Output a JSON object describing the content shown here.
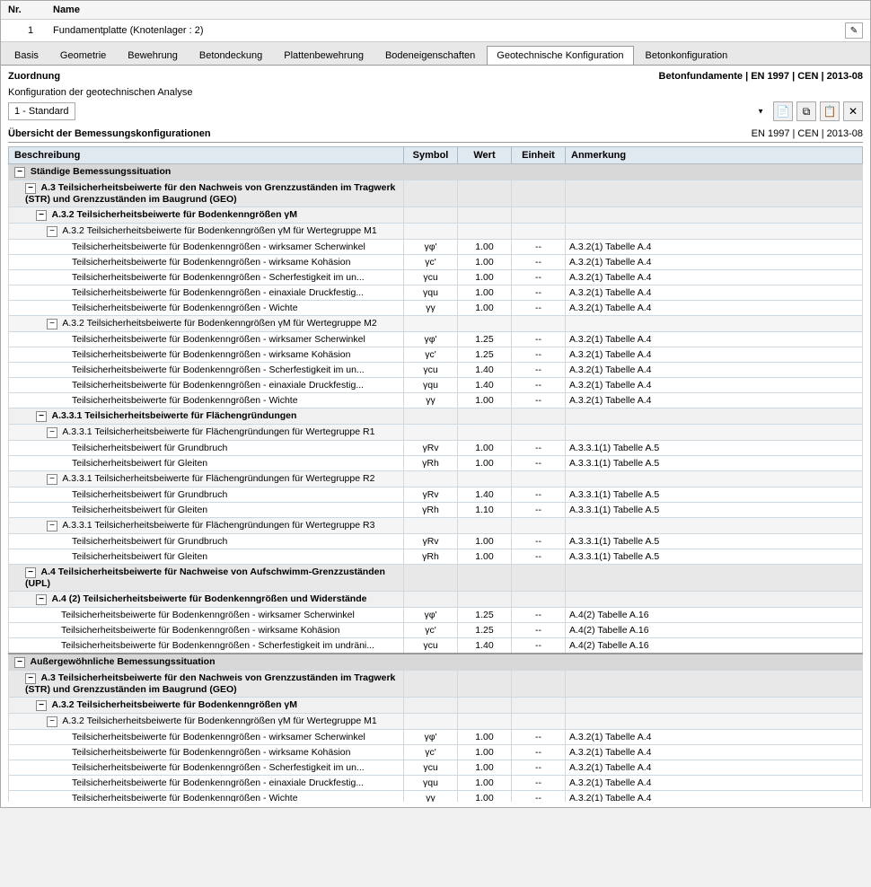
{
  "header": {
    "col_nr": "Nr.",
    "col_name": "Name",
    "row_nr": "1",
    "row_name": "Fundamentplatte (Knotenlager : 2)"
  },
  "tabs": [
    {
      "label": "Basis",
      "active": false
    },
    {
      "label": "Geometrie",
      "active": false
    },
    {
      "label": "Bewehrung",
      "active": false
    },
    {
      "label": "Betondeckung",
      "active": false
    },
    {
      "label": "Plattenbewehrung",
      "active": false
    },
    {
      "label": "Bodeneigenschaften",
      "active": false
    },
    {
      "label": "Geotechnische Konfiguration",
      "active": true
    },
    {
      "label": "Betonkonfiguration",
      "active": false
    }
  ],
  "zuordnung": {
    "label": "Zuordnung",
    "right": "Betonfundamente | EN 1997 | CEN | 2013-08"
  },
  "konfiguration": {
    "label": "Konfiguration der geotechnischen Analyse",
    "select_value": "1 - Standard",
    "options": [
      "1 - Standard"
    ]
  },
  "uebersicht": {
    "label": "Übersicht der Bemessungskonfigurationen",
    "right": "EN 1997 | CEN | 2013-08"
  },
  "table": {
    "headers": [
      "Beschreibung",
      "Symbol",
      "Wert",
      "Einheit",
      "Anmerkung"
    ],
    "rows": [
      {
        "level": 0,
        "type": "section",
        "expand": true,
        "desc": "Ständige Bemessungssituation",
        "symbol": "",
        "wert": "",
        "einheit": "",
        "anmerkung": ""
      },
      {
        "level": 1,
        "type": "level1",
        "expand": true,
        "desc": "A.3 Teilsicherheitsbeiwerte für den Nachweis von Grenzzuständen im Tragwerk (STR) und Grenzzuständen im Baugrund (GEO)",
        "symbol": "",
        "wert": "",
        "einheit": "",
        "anmerkung": ""
      },
      {
        "level": 2,
        "type": "level2",
        "expand": true,
        "desc": "A.3.2 Teilsicherheitsbeiwerte für Bodenkenngrößen γM",
        "symbol": "",
        "wert": "",
        "einheit": "",
        "anmerkung": ""
      },
      {
        "level": 3,
        "type": "level3",
        "expand": true,
        "desc": "A.3.2 Teilsicherheitsbeiwerte für Bodenkenngrößen γM für Wertegruppe M1",
        "symbol": "",
        "wert": "",
        "einheit": "",
        "anmerkung": ""
      },
      {
        "level": 4,
        "type": "leaf",
        "expand": false,
        "desc": "Teilsicherheitsbeiwerte für Bodenkenngrößen - wirksamer Scherwinkel",
        "symbol": "γφ'",
        "wert": "1.00",
        "einheit": "--",
        "anmerkung": "A.3.2(1) Tabelle A.4"
      },
      {
        "level": 4,
        "type": "leaf",
        "expand": false,
        "desc": "Teilsicherheitsbeiwerte für Bodenkenngrößen - wirksame Kohäsion",
        "symbol": "γc'",
        "wert": "1.00",
        "einheit": "--",
        "anmerkung": "A.3.2(1) Tabelle A.4"
      },
      {
        "level": 4,
        "type": "leaf",
        "expand": false,
        "desc": "Teilsicherheitsbeiwerte für Bodenkenngrößen - Scherfestigkeit im un...",
        "symbol": "γcu",
        "wert": "1.00",
        "einheit": "--",
        "anmerkung": "A.3.2(1) Tabelle A.4"
      },
      {
        "level": 4,
        "type": "leaf",
        "expand": false,
        "desc": "Teilsicherheitsbeiwerte für Bodenkenngrößen - einaxiale Druckfestig...",
        "symbol": "γqu",
        "wert": "1.00",
        "einheit": "--",
        "anmerkung": "A.3.2(1) Tabelle A.4"
      },
      {
        "level": 4,
        "type": "leaf",
        "expand": false,
        "desc": "Teilsicherheitsbeiwerte für Bodenkenngrößen - Wichte",
        "symbol": "γγ",
        "wert": "1.00",
        "einheit": "--",
        "anmerkung": "A.3.2(1) Tabelle A.4"
      },
      {
        "level": 3,
        "type": "level3",
        "expand": true,
        "desc": "A.3.2 Teilsicherheitsbeiwerte für Bodenkenngrößen γM für Wertegruppe M2",
        "symbol": "",
        "wert": "",
        "einheit": "",
        "anmerkung": ""
      },
      {
        "level": 4,
        "type": "leaf",
        "expand": false,
        "desc": "Teilsicherheitsbeiwerte für Bodenkenngrößen - wirksamer Scherwinkel",
        "symbol": "γφ'",
        "wert": "1.25",
        "einheit": "--",
        "anmerkung": "A.3.2(1) Tabelle A.4"
      },
      {
        "level": 4,
        "type": "leaf",
        "expand": false,
        "desc": "Teilsicherheitsbeiwerte für Bodenkenngrößen - wirksame Kohäsion",
        "symbol": "γc'",
        "wert": "1.25",
        "einheit": "--",
        "anmerkung": "A.3.2(1) Tabelle A.4"
      },
      {
        "level": 4,
        "type": "leaf",
        "expand": false,
        "desc": "Teilsicherheitsbeiwerte für Bodenkenngrößen - Scherfestigkeit im un...",
        "symbol": "γcu",
        "wert": "1.40",
        "einheit": "--",
        "anmerkung": "A.3.2(1) Tabelle A.4"
      },
      {
        "level": 4,
        "type": "leaf",
        "expand": false,
        "desc": "Teilsicherheitsbeiwerte für Bodenkenngrößen - einaxiale Druckfestig...",
        "symbol": "γqu",
        "wert": "1.40",
        "einheit": "--",
        "anmerkung": "A.3.2(1) Tabelle A.4"
      },
      {
        "level": 4,
        "type": "leaf",
        "expand": false,
        "desc": "Teilsicherheitsbeiwerte für Bodenkenngrößen - Wichte",
        "symbol": "γγ",
        "wert": "1.00",
        "einheit": "--",
        "anmerkung": "A.3.2(1) Tabelle A.4"
      },
      {
        "level": 2,
        "type": "level2",
        "expand": true,
        "desc": "A.3.3.1 Teilsicherheitsbeiwerte für Flächengründungen",
        "symbol": "",
        "wert": "",
        "einheit": "",
        "anmerkung": ""
      },
      {
        "level": 3,
        "type": "level3",
        "expand": true,
        "desc": "A.3.3.1 Teilsicherheitsbeiwerte für Flächengründungen für Wertegruppe R1",
        "symbol": "",
        "wert": "",
        "einheit": "",
        "anmerkung": ""
      },
      {
        "level": 4,
        "type": "leaf",
        "expand": false,
        "desc": "Teilsicherheitsbeiwert für Grundbruch",
        "symbol": "γRv",
        "wert": "1.00",
        "einheit": "--",
        "anmerkung": "A.3.3.1(1) Tabelle A.5"
      },
      {
        "level": 4,
        "type": "leaf",
        "expand": false,
        "desc": "Teilsicherheitsbeiwert für Gleiten",
        "symbol": "γRh",
        "wert": "1.00",
        "einheit": "--",
        "anmerkung": "A.3.3.1(1) Tabelle A.5"
      },
      {
        "level": 3,
        "type": "level3",
        "expand": true,
        "desc": "A.3.3.1 Teilsicherheitsbeiwerte für Flächengründungen für Wertegruppe R2",
        "symbol": "",
        "wert": "",
        "einheit": "",
        "anmerkung": ""
      },
      {
        "level": 4,
        "type": "leaf",
        "expand": false,
        "desc": "Teilsicherheitsbeiwert für Grundbruch",
        "symbol": "γRv",
        "wert": "1.40",
        "einheit": "--",
        "anmerkung": "A.3.3.1(1) Tabelle A.5"
      },
      {
        "level": 4,
        "type": "leaf",
        "expand": false,
        "desc": "Teilsicherheitsbeiwert für Gleiten",
        "symbol": "γRh",
        "wert": "1.10",
        "einheit": "--",
        "anmerkung": "A.3.3.1(1) Tabelle A.5"
      },
      {
        "level": 3,
        "type": "level3",
        "expand": true,
        "desc": "A.3.3.1 Teilsicherheitsbeiwerte für Flächengründungen für Wertegruppe R3",
        "symbol": "",
        "wert": "",
        "einheit": "",
        "anmerkung": ""
      },
      {
        "level": 4,
        "type": "leaf",
        "expand": false,
        "desc": "Teilsicherheitsbeiwert für Grundbruch",
        "symbol": "γRv",
        "wert": "1.00",
        "einheit": "--",
        "anmerkung": "A.3.3.1(1) Tabelle A.5"
      },
      {
        "level": 4,
        "type": "leaf",
        "expand": false,
        "desc": "Teilsicherheitsbeiwert für Gleiten",
        "symbol": "γRh",
        "wert": "1.00",
        "einheit": "--",
        "anmerkung": "A.3.3.1(1) Tabelle A.5"
      },
      {
        "level": 1,
        "type": "level1",
        "expand": true,
        "desc": "A.4 Teilsicherheitsbeiwerte für Nachweise von Aufschwimm-Grenzzuständen (UPL)",
        "symbol": "",
        "wert": "",
        "einheit": "",
        "anmerkung": ""
      },
      {
        "level": 2,
        "type": "level2",
        "expand": true,
        "desc": "A.4 (2) Teilsicherheitsbeiwerte für Bodenkenngrößen und Widerstände",
        "symbol": "",
        "wert": "",
        "einheit": "",
        "anmerkung": ""
      },
      {
        "level": 3,
        "type": "leaf",
        "expand": false,
        "desc": "Teilsicherheitsbeiwerte für Bodenkenngrößen - wirksamer Scherwinkel",
        "symbol": "γφ'",
        "wert": "1.25",
        "einheit": "--",
        "anmerkung": "A.4(2) Tabelle A.16"
      },
      {
        "level": 3,
        "type": "leaf",
        "expand": false,
        "desc": "Teilsicherheitsbeiwerte für Bodenkenngrößen - wirksame Kohäsion",
        "symbol": "γc'",
        "wert": "1.25",
        "einheit": "--",
        "anmerkung": "A.4(2) Tabelle A.16"
      },
      {
        "level": 3,
        "type": "leaf",
        "expand": false,
        "desc": "Teilsicherheitsbeiwerte für Bodenkenngrößen - Scherfestigkeit im undräni...",
        "symbol": "γcu",
        "wert": "1.40",
        "einheit": "--",
        "anmerkung": "A.4(2) Tabelle A.16"
      },
      {
        "level": 0,
        "type": "section",
        "expand": true,
        "desc": "Außergewöhnliche Bemessungssituation",
        "symbol": "",
        "wert": "",
        "einheit": "",
        "anmerkung": ""
      },
      {
        "level": 1,
        "type": "level1",
        "expand": true,
        "desc": "A.3 Teilsicherheitsbeiwerte für den Nachweis von Grenzzuständen im Tragwerk (STR) und Grenzzuständen im Baugrund (GEO)",
        "symbol": "",
        "wert": "",
        "einheit": "",
        "anmerkung": ""
      },
      {
        "level": 2,
        "type": "level2",
        "expand": true,
        "desc": "A.3.2 Teilsicherheitsbeiwerte für Bodenkenngrößen γM",
        "symbol": "",
        "wert": "",
        "einheit": "",
        "anmerkung": ""
      },
      {
        "level": 3,
        "type": "level3",
        "expand": true,
        "desc": "A.3.2 Teilsicherheitsbeiwerte für Bodenkenngrößen γM für Wertegruppe M1",
        "symbol": "",
        "wert": "",
        "einheit": "",
        "anmerkung": ""
      },
      {
        "level": 4,
        "type": "leaf",
        "expand": false,
        "desc": "Teilsicherheitsbeiwerte für Bodenkenngrößen - wirksamer Scherwinkel",
        "symbol": "γφ'",
        "wert": "1.00",
        "einheit": "--",
        "anmerkung": "A.3.2(1) Tabelle A.4"
      },
      {
        "level": 4,
        "type": "leaf",
        "expand": false,
        "desc": "Teilsicherheitsbeiwerte für Bodenkenngrößen - wirksame Kohäsion",
        "symbol": "γc'",
        "wert": "1.00",
        "einheit": "--",
        "anmerkung": "A.3.2(1) Tabelle A.4"
      },
      {
        "level": 4,
        "type": "leaf",
        "expand": false,
        "desc": "Teilsicherheitsbeiwerte für Bodenkenngrößen - Scherfestigkeit im un...",
        "symbol": "γcu",
        "wert": "1.00",
        "einheit": "--",
        "anmerkung": "A.3.2(1) Tabelle A.4"
      },
      {
        "level": 4,
        "type": "leaf",
        "expand": false,
        "desc": "Teilsicherheitsbeiwerte für Bodenkenngrößen - einaxiale Druckfestig...",
        "symbol": "γqu",
        "wert": "1.00",
        "einheit": "--",
        "anmerkung": "A.3.2(1) Tabelle A.4"
      },
      {
        "level": 4,
        "type": "leaf",
        "expand": false,
        "desc": "Teilsicherheitsbeiwerte für Bodenkenngrößen - Wichte",
        "symbol": "γγ",
        "wert": "1.00",
        "einheit": "--",
        "anmerkung": "A.3.2(1) Tabelle A.4"
      }
    ]
  },
  "icons": {
    "edit": "✎",
    "expand": "−",
    "collapse": "+",
    "dropdown_arrow": "▼",
    "copy": "⧉",
    "paste": "📋",
    "new": "📄",
    "delete": "✕"
  }
}
